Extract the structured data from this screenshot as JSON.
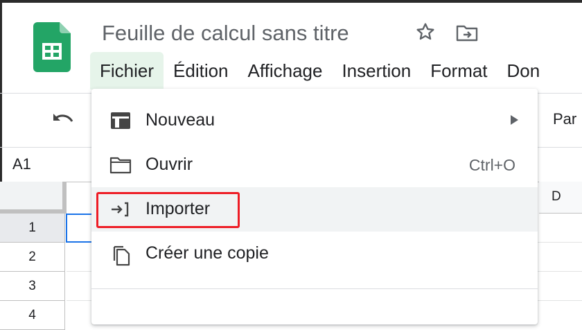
{
  "app": {
    "doc_title": "Feuille de calcul sans titre",
    "name_box": "A1",
    "toolbar_right_text": "Par"
  },
  "menubar": {
    "items": [
      {
        "label": "Fichier"
      },
      {
        "label": "Édition"
      },
      {
        "label": "Affichage"
      },
      {
        "label": "Insertion"
      },
      {
        "label": "Format"
      },
      {
        "label": "Don"
      }
    ]
  },
  "file_menu": {
    "items": [
      {
        "label": "Nouveau",
        "icon": "new-sheet-icon",
        "shortcut": ""
      },
      {
        "label": "Ouvrir",
        "icon": "folder-icon",
        "shortcut": "Ctrl+O"
      },
      {
        "label": "Importer",
        "icon": "import-icon",
        "shortcut": ""
      },
      {
        "label": "Créer une copie",
        "icon": "copy-icon",
        "shortcut": ""
      }
    ]
  },
  "grid": {
    "rows": [
      "1",
      "2",
      "3",
      "4"
    ],
    "visible_column": "D"
  },
  "colors": {
    "sheets_green": "#23a566",
    "active_menu_bg": "#e6f4ea",
    "highlight_border": "#ee1c25",
    "selection_blue": "#1a73e8"
  }
}
